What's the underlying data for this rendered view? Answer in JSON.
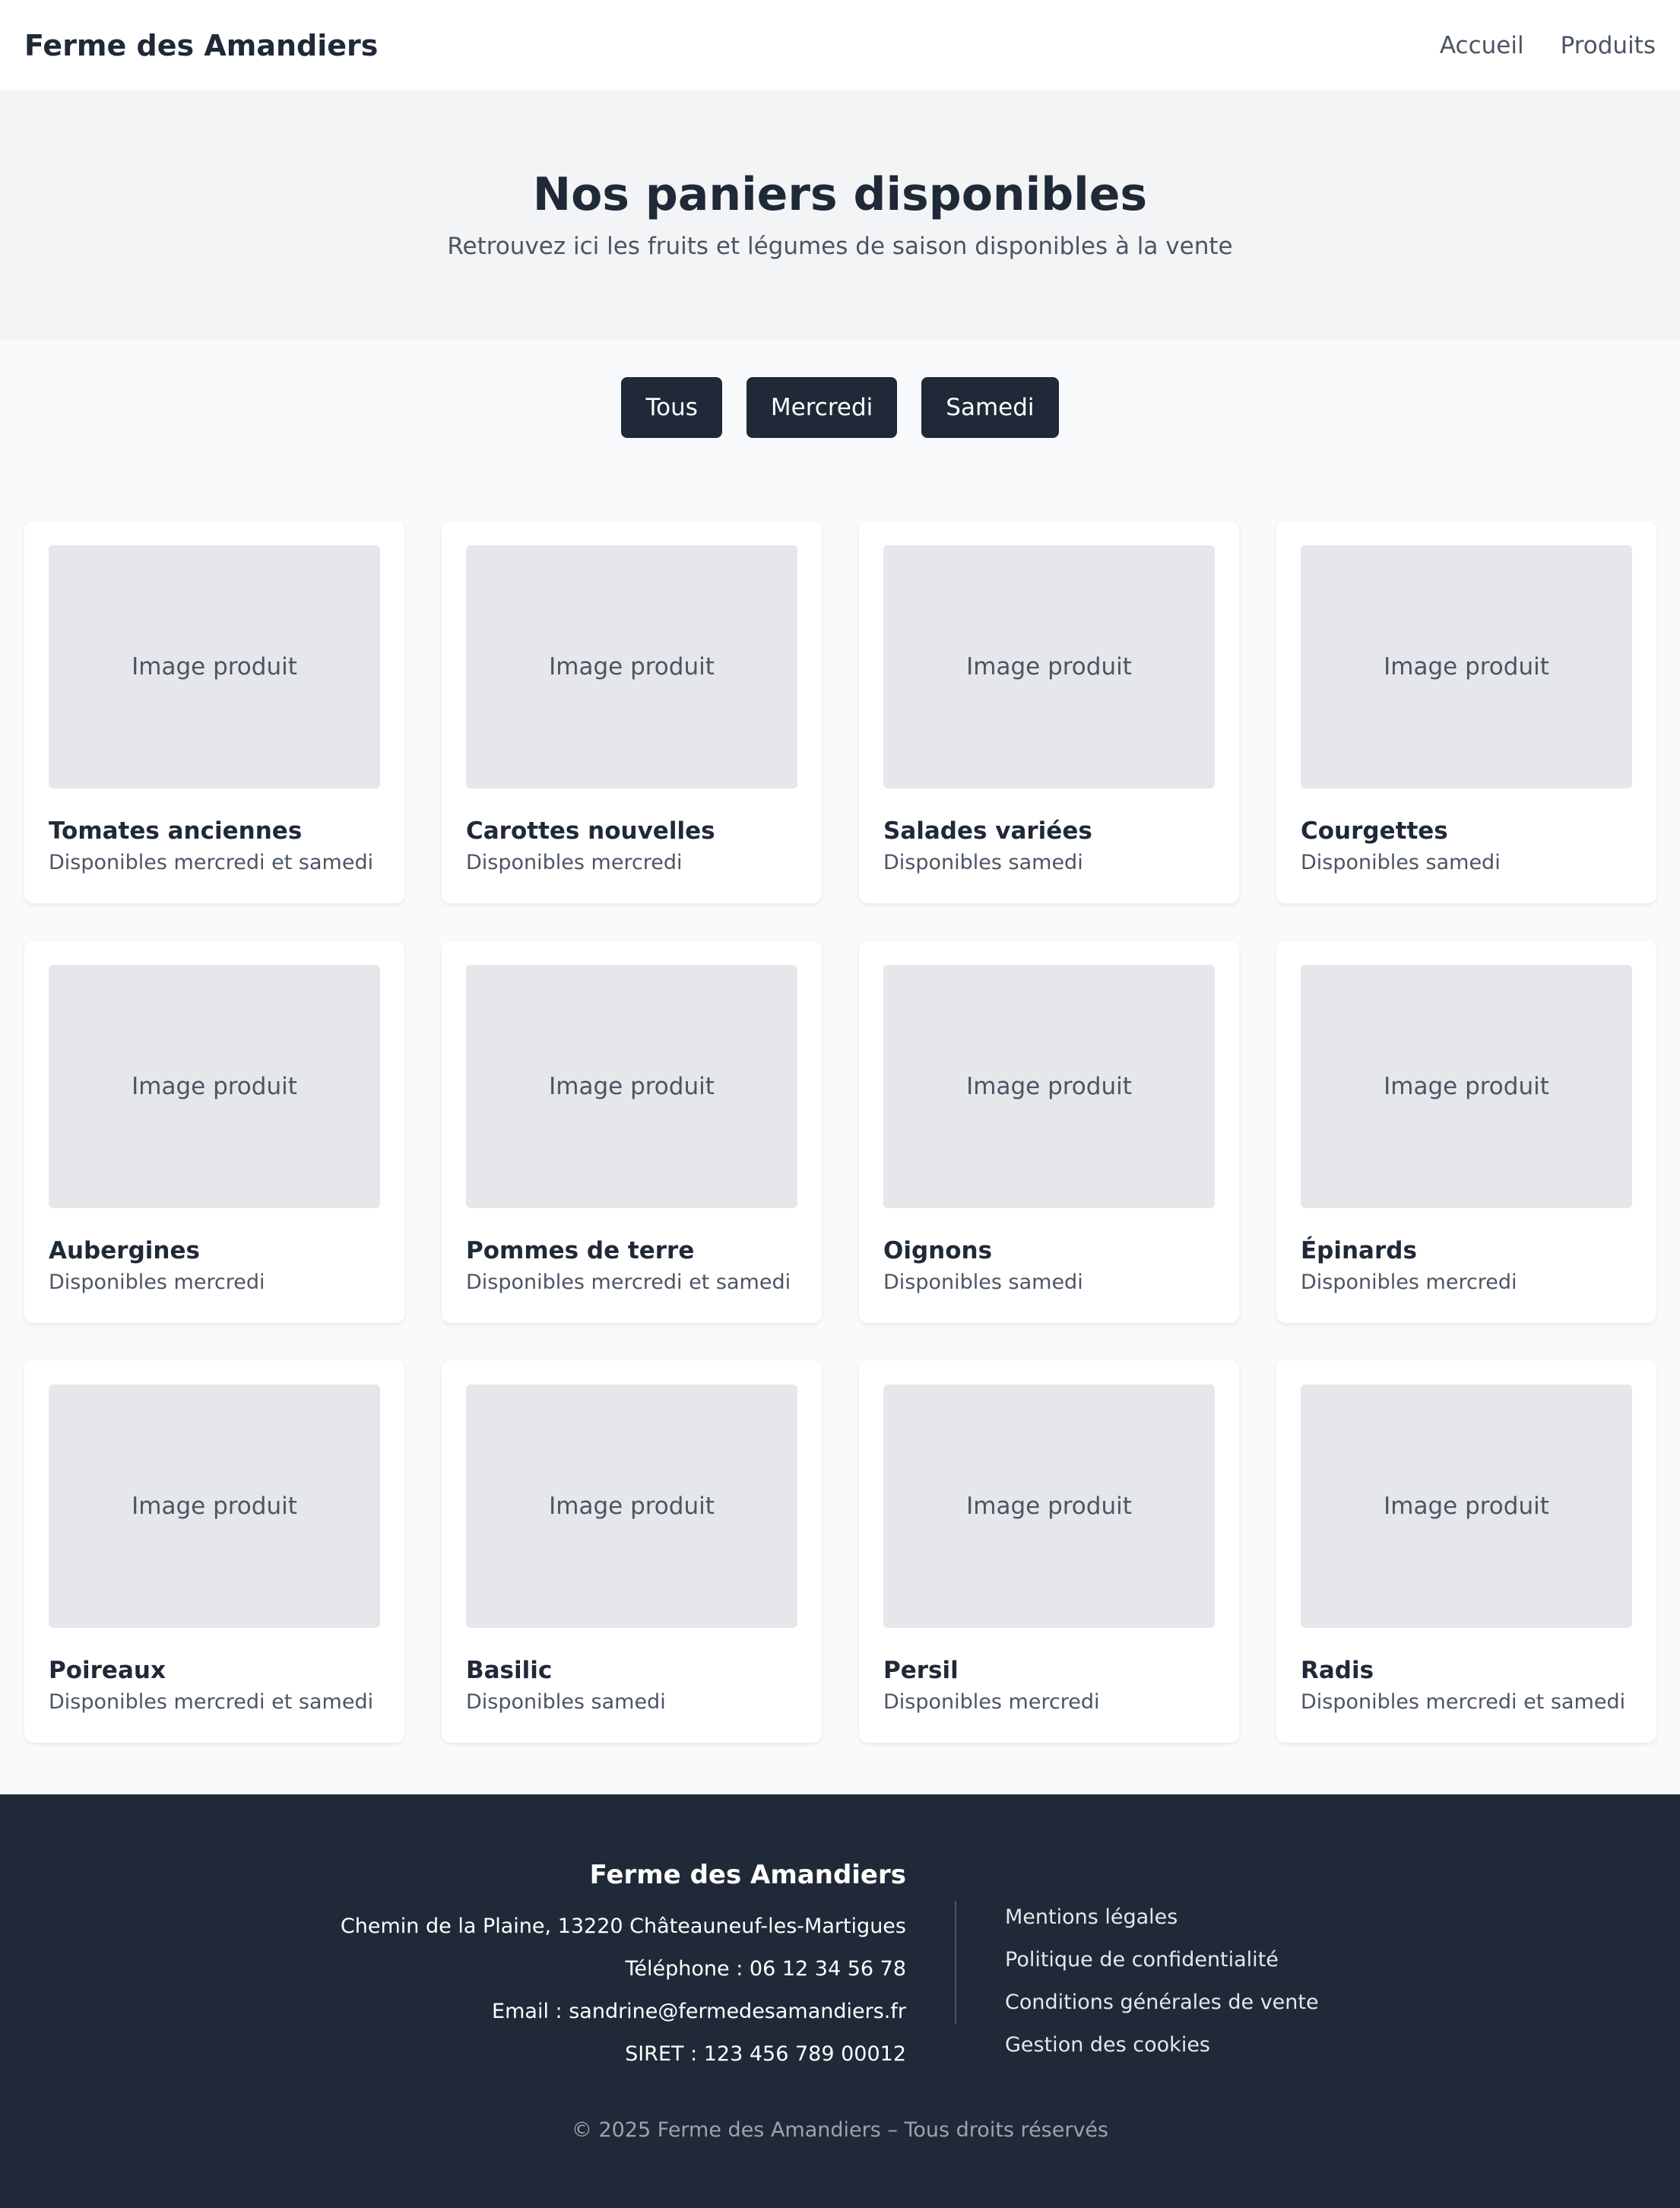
{
  "header": {
    "brand": "Ferme des Amandiers",
    "nav": [
      "Accueil",
      "Produits"
    ]
  },
  "hero": {
    "title": "Nos paniers disponibles",
    "subtitle": "Retrouvez ici les fruits et légumes de saison disponibles à la vente"
  },
  "filters": [
    "Tous",
    "Mercredi",
    "Samedi"
  ],
  "image_placeholder": "Image produit",
  "products": [
    {
      "name": "Tomates anciennes",
      "availability": "Disponibles mercredi et samedi"
    },
    {
      "name": "Carottes nouvelles",
      "availability": "Disponibles mercredi"
    },
    {
      "name": "Salades variées",
      "availability": "Disponibles samedi"
    },
    {
      "name": "Courgettes",
      "availability": "Disponibles samedi"
    },
    {
      "name": "Aubergines",
      "availability": "Disponibles mercredi"
    },
    {
      "name": "Pommes de terre",
      "availability": "Disponibles mercredi et samedi"
    },
    {
      "name": "Oignons",
      "availability": "Disponibles samedi"
    },
    {
      "name": "Épinards",
      "availability": "Disponibles mercredi"
    },
    {
      "name": "Poireaux",
      "availability": "Disponibles mercredi et samedi"
    },
    {
      "name": "Basilic",
      "availability": "Disponibles samedi"
    },
    {
      "name": "Persil",
      "availability": "Disponibles mercredi"
    },
    {
      "name": "Radis",
      "availability": "Disponibles mercredi et samedi"
    }
  ],
  "footer": {
    "title": "Ferme des Amandiers",
    "address": "Chemin de la Plaine, 13220 Châteauneuf-les-Martigues",
    "phone": "Téléphone : 06 12 34 56 78",
    "email": "Email : sandrine@fermedesamandiers.fr",
    "siret": "SIRET : 123 456 789 00012",
    "links": [
      "Mentions légales",
      "Politique de confidentialité",
      "Conditions générales de vente",
      "Gestion des cookies"
    ],
    "copyright": "© 2025 Ferme des Amandiers – Tous droits réservés"
  },
  "colors": {
    "dark": "#1f2937",
    "muted": "#4b5563",
    "placeholder_bg": "#e5e7eb",
    "hero_bg": "#f3f4f6",
    "page_bg": "#f9fafb"
  }
}
